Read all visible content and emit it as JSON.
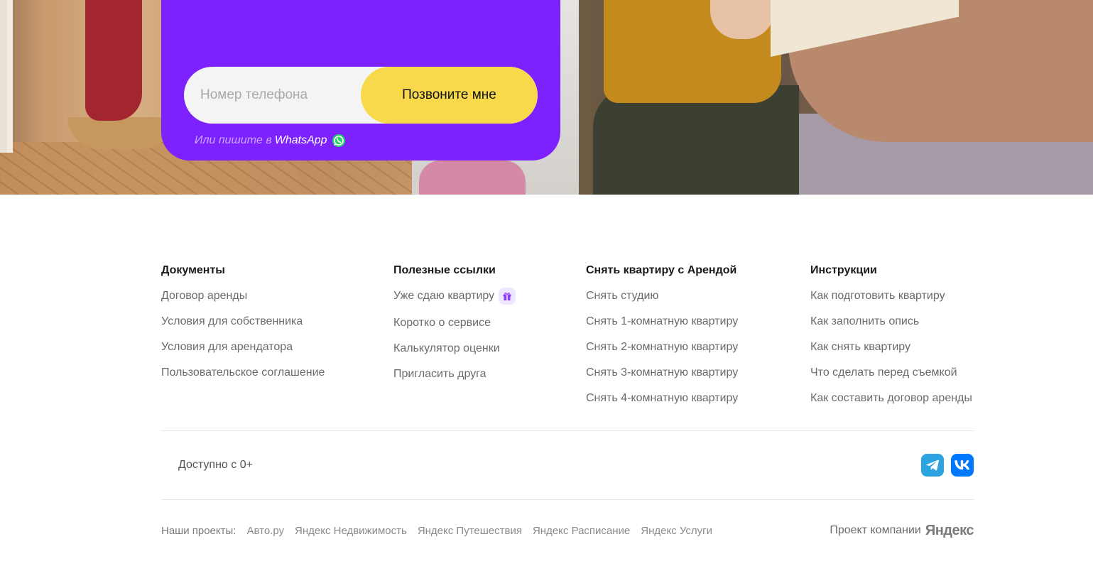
{
  "hero": {
    "phone_placeholder": "Номер телефона",
    "call_button": "Позвоните мне",
    "whatsapp_prefix": "Или пишите в",
    "whatsapp_link": "WhatsApp",
    "colors": {
      "card": "#7d22ff",
      "button": "#f7d94b",
      "whatsapp": "#25d366"
    }
  },
  "footer": {
    "columns": [
      {
        "title": "Документы",
        "links": [
          "Договор аренды",
          "Условия для собственника",
          "Условия для арендатора",
          "Пользовательское соглашение"
        ]
      },
      {
        "title": "Полезные ссылки",
        "links": [
          "Уже сдаю квартиру",
          "Коротко о сервисе",
          "Калькулятор оценки",
          "Пригласить друга"
        ],
        "gift_icon": "gift-icon"
      },
      {
        "title": "Снять квартиру с Арендой",
        "links": [
          "Снять студию",
          "Снять 1-комнатную квартиру",
          "Снять 2-комнатную квартиру",
          "Снять 3-комнатную квартиру",
          "Снять 4-комнатную квартиру"
        ]
      },
      {
        "title": "Инструкции",
        "links": [
          "Как подготовить квартиру",
          "Как заполнить опись",
          "Как снять квартиру",
          "Что сделать перед съемкой",
          "Как составить договор аренды"
        ]
      }
    ],
    "age_note": "Доступно с 0+",
    "social": {
      "telegram": "telegram-icon",
      "vk": "vk-icon"
    },
    "projects_label": "Наши проекты:",
    "projects": [
      "Авто.ру",
      "Яндекс Недвижимость",
      "Яндекс Путешествия",
      "Яндекс Расписание",
      "Яндекс Услуги"
    ],
    "company_label": "Проект компании",
    "company_logo": "Яндекс"
  }
}
